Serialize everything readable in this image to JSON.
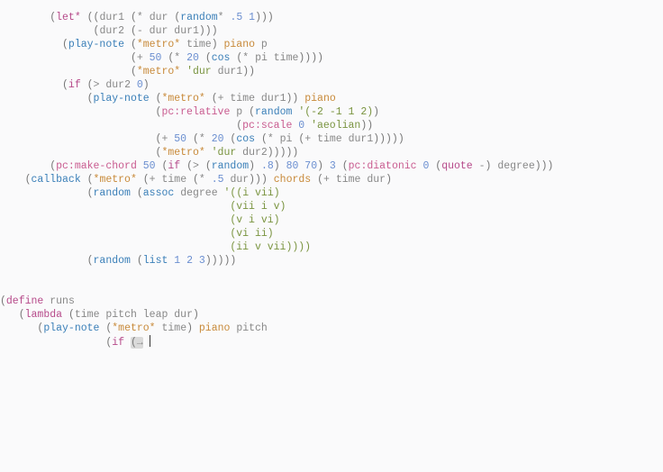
{
  "code": {
    "l01": {
      "indent": "        ",
      "let": "let*",
      "dur1a": "dur1",
      "dur1b": "dur",
      "rand": "random",
      "num": ".5",
      "one": "1"
    },
    "l02": {
      "indent": "               ",
      "dur2": "dur2",
      "dur": "dur",
      "dur1": "dur1"
    },
    "l03": {
      "indent": "          ",
      "play": "play-note",
      "metro": "*metro*",
      "time": "time",
      "piano": "piano",
      "p": "p"
    },
    "l04": {
      "indent": "                     ",
      "plus": "+",
      "n50": "50",
      "n20": "20",
      "cos": "cos",
      "pi": "pi",
      "time": "time"
    },
    "l05": {
      "indent": "                     ",
      "metro": "*metro*",
      "durlit": "'dur",
      "dur1": "dur1"
    },
    "l06": {
      "indent": "          ",
      "if": "if",
      "gt": ">",
      "dur2": "dur2",
      "z": "0"
    },
    "l07": {
      "indent": "              ",
      "play": "play-note",
      "metro": "*metro*",
      "plus": "+",
      "time": "time",
      "dur1": "dur1",
      "piano": "piano"
    },
    "l08": {
      "indent": "                         ",
      "pcrel": "pc:relative",
      "p": "p",
      "rand": "random",
      "lst": "'(-2 -1 1 2)"
    },
    "l09": {
      "indent": "                                      ",
      "pcscale": "pc:scale",
      "z": "0",
      "aeol": "'aeolian"
    },
    "l10": {
      "indent": "                         ",
      "plus": "+",
      "n50": "50",
      "n20": "20",
      "cos": "cos",
      "pi": "pi",
      "time": "time",
      "dur1": "dur1"
    },
    "l11": {
      "indent": "                         ",
      "metro": "*metro*",
      "durlit": "'dur",
      "dur2": "dur2"
    },
    "l12": {
      "indent": "        ",
      "pcmk": "pc:make-chord",
      "n50": "50",
      "if": "if",
      "gt": ">",
      "rand": "random",
      "p8": ".8",
      "n80": "80",
      "n70": "70",
      "n3": "3",
      "pcdi": "pc:diatonic",
      "z": "0",
      "q": "quote",
      "dash": "-",
      "deg": "degree"
    },
    "l13": {
      "indent": "    ",
      "cb": "callback",
      "metro": "*metro*",
      "plus": "+",
      "time": "time",
      "star": "*",
      "p5": ".5",
      "dur": "dur",
      "chords": "chords",
      "time2": "time",
      "dur2": "dur"
    },
    "l14": {
      "indent": "              ",
      "rand": "random",
      "assoc": "assoc",
      "deg": "degree",
      "data": "'((i vii)"
    },
    "l15": {
      "indent": "                                     ",
      "data": "(vii i v)"
    },
    "l16": {
      "indent": "                                     ",
      "data": "(v i vi)"
    },
    "l17": {
      "indent": "                                     ",
      "data": "(vi ii)"
    },
    "l18": {
      "indent": "                                     ",
      "data": "(ii v vii))))"
    },
    "l19": {
      "indent": "              ",
      "rand": "random",
      "list": "list",
      "n1": "1",
      "n2": "2",
      "n3": "3"
    },
    "l20": "",
    "l21": "",
    "l22": {
      "define": "define",
      "name": "runs"
    },
    "l23": {
      "indent": "   ",
      "lam": "lambda",
      "args": "time pitch leap dur"
    },
    "l24": {
      "indent": "      ",
      "play": "play-note",
      "metro": "*metro*",
      "time": "time",
      "piano": "piano",
      "pitch": "pitch"
    },
    "l25": {
      "indent": "                 ",
      "if": "if",
      "arrow": "→"
    }
  }
}
